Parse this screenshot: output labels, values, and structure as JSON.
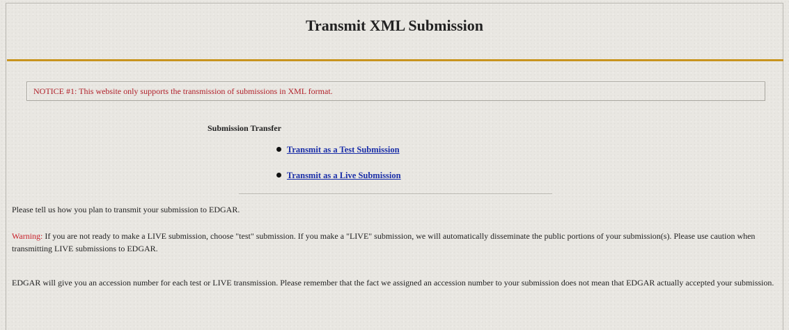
{
  "page": {
    "title": "Transmit XML Submission"
  },
  "notice": {
    "text": "NOTICE #1: This website only supports the transmission of submissions in XML format."
  },
  "transfer": {
    "heading": "Submission Transfer",
    "links": [
      {
        "label": "Transmit as a Test Submission"
      },
      {
        "label": "Transmit as a Live Submission"
      }
    ]
  },
  "info": {
    "instruction": "Please tell us how you plan to transmit your submission to EDGAR.",
    "warning_label": "Warning:",
    "warning_text": " If you are not ready to make a LIVE submission, choose \"test\" submission. If you make a \"LIVE\" submission, we will automatically disseminate the public portions of your submission(s). Please use caution when transmitting LIVE submissions to EDGAR.",
    "accession_note": "EDGAR will give you an accession number for each test or LIVE transmission. Please remember that the fact we assigned an accession number to your submission does not mean that EDGAR actually accepted your submission."
  },
  "colors": {
    "title_rule": "#c8941e",
    "notice_text": "#b0202a",
    "link": "#1a2ea8",
    "warning": "#c8202a"
  }
}
